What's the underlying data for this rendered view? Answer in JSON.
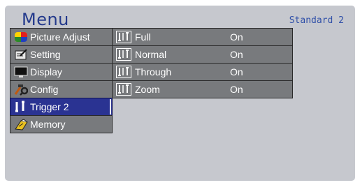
{
  "header": {
    "title": "Menu",
    "preset": "Standard 2"
  },
  "left_menu": [
    {
      "label": "Picture Adjust",
      "icon": "picture-adjust-icon"
    },
    {
      "label": "Setting",
      "icon": "setting-icon"
    },
    {
      "label": "Display",
      "icon": "display-icon"
    },
    {
      "label": "Config",
      "icon": "config-icon"
    },
    {
      "label": "Trigger 2",
      "icon": "trigger-icon",
      "selected": true
    },
    {
      "label": "Memory",
      "icon": "memory-icon"
    }
  ],
  "sub_menu": [
    {
      "label": "Full",
      "value": "On",
      "icon": "trigger-mode-icon"
    },
    {
      "label": "Normal",
      "value": "On",
      "icon": "trigger-mode-icon"
    },
    {
      "label": "Through",
      "value": "On",
      "icon": "trigger-mode-icon"
    },
    {
      "label": "Zoom",
      "value": "On",
      "icon": "trigger-mode-icon"
    }
  ],
  "colors": {
    "panel": "#c6c8ce",
    "item": "#787a7d",
    "selected": "#2a3392",
    "title": "#243a8c"
  }
}
